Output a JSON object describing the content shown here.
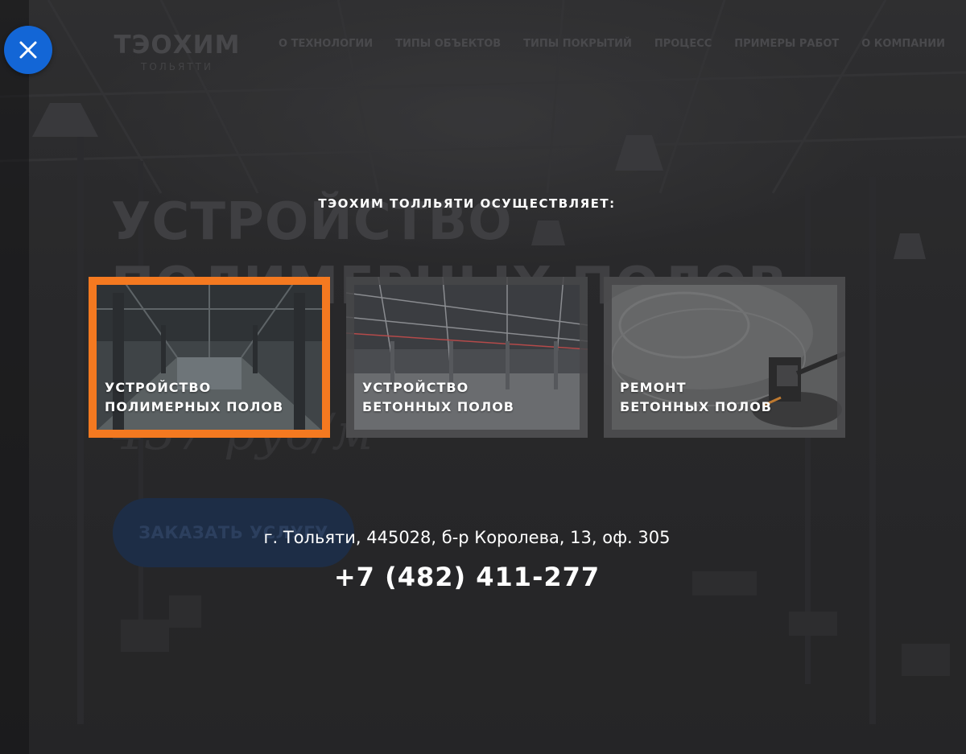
{
  "header": {
    "logo_main": "ТЭОХИМ",
    "logo_sub": "ТОЛЬЯТТИ",
    "nav": [
      "О ТЕХНОЛОГИИ",
      "ТИПЫ ОБЪЕКТОВ",
      "ТИПЫ ПОКРЫТИЙ",
      "ПРОЦЕСС",
      "ПРИМЕРЫ РАБОТ",
      "О КОМПАНИИ"
    ]
  },
  "hero": {
    "title_line1": "УСТРОЙСТВО",
    "title_line2": "ПОЛИМЕРНЫХ ПОЛОВ",
    "price": "437 руб/м",
    "order_button": "ЗАКАЗАТЬ УСЛУГУ"
  },
  "modal": {
    "close_icon": "close-icon",
    "heading": "ТЭОХИМ ТОЛЛЬЯТИ ОСУЩЕСТВЛЯЕТ:",
    "services": [
      {
        "line1": "УСТРОЙСТВО",
        "line2": "ПОЛИМЕРНЫХ ПОЛОВ",
        "selected": true
      },
      {
        "line1": "УСТРОЙСТВО",
        "line2": "БЕТОННЫХ ПОЛОВ",
        "selected": false
      },
      {
        "line1": "РЕМОНТ",
        "line2": "БЕТОННЫХ ПОЛОВ",
        "selected": false
      }
    ],
    "address": "г. Тольяти, 445028, б-р Королева, 13, оф. 305",
    "phone": "+7 (482) 411-277"
  },
  "colors": {
    "accent_blue": "#1366d6",
    "selected_border": "#f47920",
    "order_button": "#1f3658",
    "overlay": "#2a2a2b"
  }
}
